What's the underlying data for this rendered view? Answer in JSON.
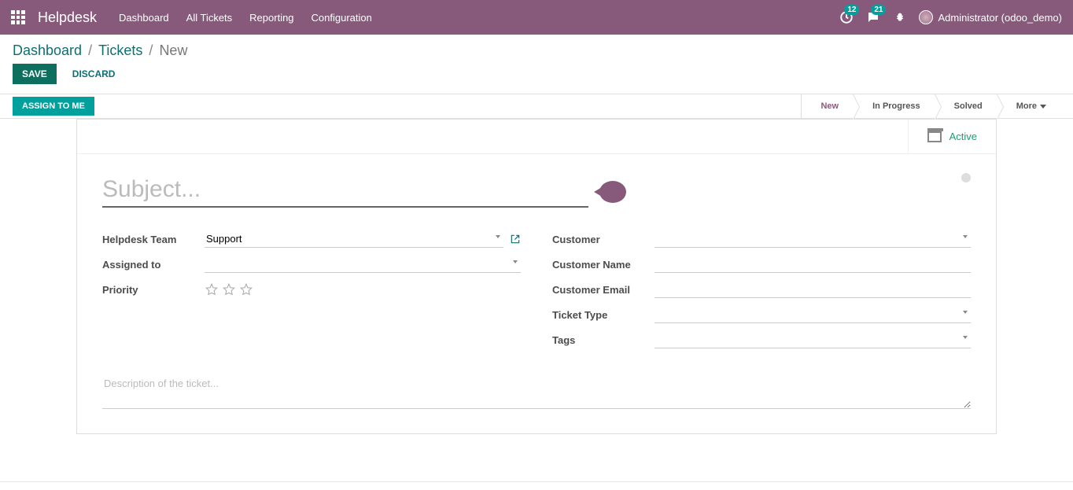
{
  "topnav": {
    "brand": "Helpdesk",
    "links": [
      "Dashboard",
      "All Tickets",
      "Reporting",
      "Configuration"
    ],
    "badge1": "12",
    "badge2": "21",
    "user": "Administrator (odoo_demo)"
  },
  "breadcrumb": {
    "items": [
      "Dashboard",
      "Tickets"
    ],
    "current": "New",
    "sep": "/"
  },
  "actions": {
    "save": "Save",
    "discard": "Discard"
  },
  "statusbar": {
    "assign": "Assign to me",
    "stages": [
      "New",
      "In Progress",
      "Solved",
      "More"
    ],
    "active_stage_index": 0
  },
  "sheet": {
    "active_label": "Active",
    "subject_placeholder": "Subject...",
    "subject_value": "",
    "fields": {
      "team_label": "Helpdesk Team",
      "team_value": "Support",
      "assigned_label": "Assigned to",
      "assigned_value": "",
      "priority_label": "Priority",
      "customer_label": "Customer",
      "customer_value": "",
      "customer_name_label": "Customer Name",
      "customer_name_value": "",
      "customer_email_label": "Customer Email",
      "customer_email_value": "",
      "ticket_type_label": "Ticket Type",
      "ticket_type_value": "",
      "tags_label": "Tags",
      "tags_value": ""
    },
    "description_placeholder": "Description of the ticket..."
  }
}
